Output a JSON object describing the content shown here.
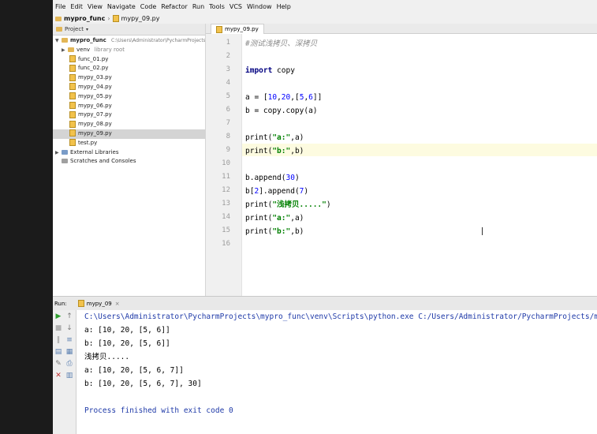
{
  "menu": [
    "File",
    "Edit",
    "View",
    "Navigate",
    "Code",
    "Refactor",
    "Run",
    "Tools",
    "VCS",
    "Window",
    "Help"
  ],
  "breadcrumb": {
    "project": "mypro_func",
    "file": "mypy_09.py"
  },
  "project_panel": {
    "title": "Project",
    "root_label": "mypro_func",
    "root_path": "C:\\Users\\Administrator\\PycharmProjects\\",
    "venv": "venv",
    "venv_note": "library root",
    "files": [
      "func_01.py",
      "func_02.py",
      "mypy_03.py",
      "mypy_04.py",
      "mypy_05.py",
      "mypy_06.py",
      "mypy_07.py",
      "mypy_08.py",
      "mypy_09.py",
      "test.py"
    ],
    "selected_file": "mypy_09.py",
    "extra": [
      "External Libraries",
      "Scratches and Consoles"
    ]
  },
  "editor": {
    "tab": "mypy_09.py",
    "line_numbers": [
      "1",
      "2",
      "3",
      "4",
      "5",
      "6",
      "7",
      "8",
      "9",
      "10",
      "11",
      "12",
      "13",
      "14",
      "15",
      "16"
    ],
    "comment": "#测试浅拷贝、深拷贝",
    "import_kw": "import",
    "import_mod": " copy",
    "l5_a": "a = [",
    "l5_n1": "10",
    "l5_c1": ",",
    "l5_n2": "20",
    "l5_c2": ",[",
    "l5_n3": "5",
    "l5_c3": ",",
    "l5_n4": "6",
    "l5_end": "]]",
    "l6": "b = copy.copy(a)",
    "l8_fn": "print(",
    "l8_str": "\"a:\"",
    "l8_end": ",a)",
    "l9_fn": "print(",
    "l9_str": "\"b:\"",
    "l9_end": ",b)",
    "l11_a": "b.append(",
    "l11_n": "30",
    "l11_end": ")",
    "l12_a": "b[",
    "l12_n1": "2",
    "l12_b": "].append(",
    "l12_n2": "7",
    "l12_end": ")",
    "l13_fn": "print(",
    "l13_str": "\"浅拷贝.....\"",
    "l13_end": ")",
    "l14_fn": "print(",
    "l14_str": "\"a:\"",
    "l14_end": ",a)",
    "l15_fn": "print(",
    "l15_str": "\"b:\"",
    "l15_end": ",b)"
  },
  "run": {
    "label": "Run:",
    "tab": "mypy_09",
    "command": "C:\\Users\\Administrator\\PycharmProjects\\mypro_func\\venv\\Scripts\\python.exe C:/Users/Administrator/PycharmProjects/my",
    "output": [
      "a: [10, 20, [5, 6]]",
      "b: [10, 20, [5, 6]]",
      "浅拷贝.....",
      "a: [10, 20, [5, 6, 7]]",
      "b: [10, 20, [5, 6, 7], 30]"
    ],
    "finished": "Process finished with exit code 0"
  },
  "colors": {
    "keyword": "#000080",
    "string": "#008000",
    "number": "#0000ff",
    "comment": "#8a8a8a",
    "console_link": "#1f3aa8"
  }
}
